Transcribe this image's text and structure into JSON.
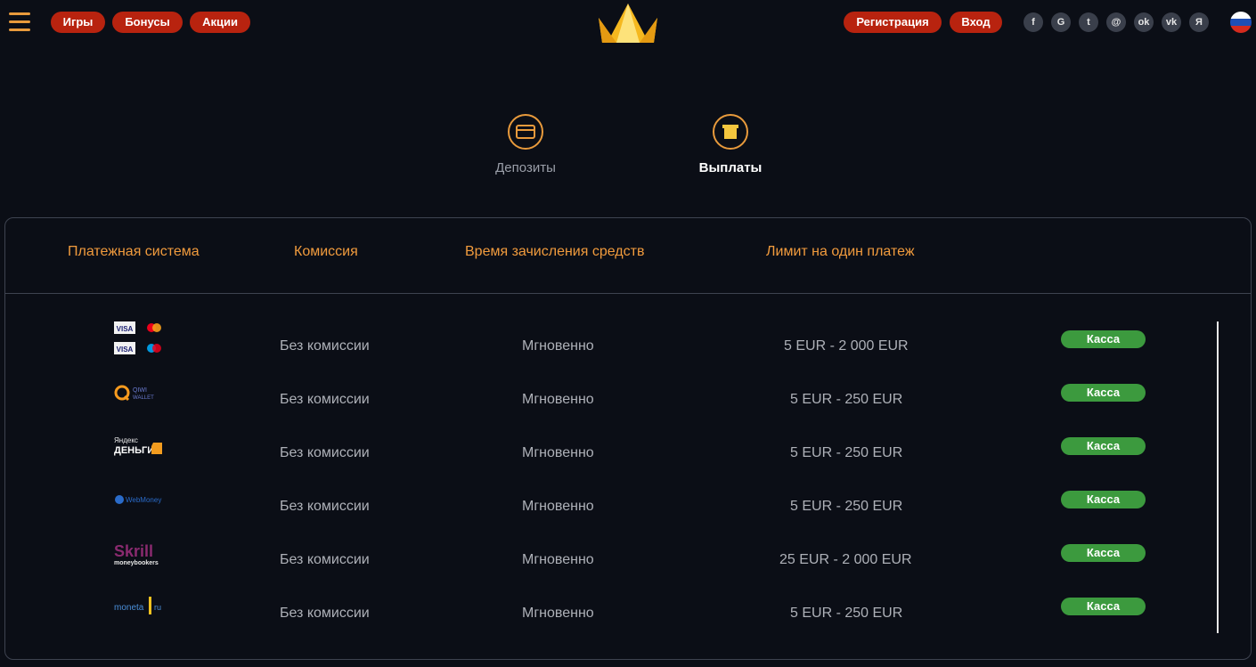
{
  "header": {
    "nav": [
      "Игры",
      "Бонусы",
      "Акции"
    ],
    "register_label": "Регистрация",
    "login_label": "Вход",
    "socials": [
      {
        "name": "facebook-icon",
        "glyph": "f"
      },
      {
        "name": "google-icon",
        "glyph": "G"
      },
      {
        "name": "twitter-icon",
        "glyph": "t"
      },
      {
        "name": "mail-ru-icon",
        "glyph": "@"
      },
      {
        "name": "odnoklassniki-icon",
        "glyph": "ok"
      },
      {
        "name": "vk-icon",
        "glyph": "vk"
      },
      {
        "name": "yandex-icon",
        "glyph": "Я"
      }
    ],
    "language_flag": "ru-flag-icon"
  },
  "tabs": [
    {
      "label": "Депозиты",
      "icon": "card-icon",
      "active": false
    },
    {
      "label": "Выплаты",
      "icon": "wallet-icon",
      "active": true
    }
  ],
  "table": {
    "headers": [
      "Платежная система",
      "Комиссия",
      "Время зачисления средств",
      "Лимит на один платеж"
    ],
    "rows": [
      {
        "logo": "visa-mastercard-logo",
        "commission": "Без комиссии",
        "time": "Мгновенно",
        "limit": "5 EUR - 2 000 EUR",
        "action": "Касса"
      },
      {
        "logo": "qiwi-wallet-logo",
        "commission": "Без комиссии",
        "time": "Мгновенно",
        "limit": "5 EUR - 250 EUR",
        "action": "Касса"
      },
      {
        "logo": "yandex-money-logo",
        "commission": "Без комиссии",
        "time": "Мгновенно",
        "limit": "5 EUR - 250 EUR",
        "action": "Касса"
      },
      {
        "logo": "webmoney-logo",
        "commission": "Без комиссии",
        "time": "Мгновенно",
        "limit": "5 EUR - 250 EUR",
        "action": "Касса"
      },
      {
        "logo": "skrill-logo",
        "commission": "Без комиссии",
        "time": "Мгновенно",
        "limit": "25 EUR - 2 000 EUR",
        "action": "Касса"
      },
      {
        "logo": "moneta-ru-logo",
        "commission": "Без комиссии",
        "time": "Мгновенно",
        "limit": "5 EUR - 250 EUR",
        "action": "Касса"
      }
    ]
  },
  "logo_text": {
    "visa": "VISA",
    "qiwi": "QIWI",
    "qiwi_sub": "WALLET",
    "yandex": "Яндекс",
    "yandex_sub": "ДЕНЬГИ",
    "webmoney": "WebMoney",
    "skrill": "Skrill",
    "skrill_sub": "moneybookers",
    "moneta": "moneta",
    "moneta_ru": "ru"
  },
  "colors": {
    "accent": "#e89a3c",
    "pill_red": "#b8230f",
    "kassa_green": "#3c9a3e",
    "background": "#0b0e16"
  }
}
